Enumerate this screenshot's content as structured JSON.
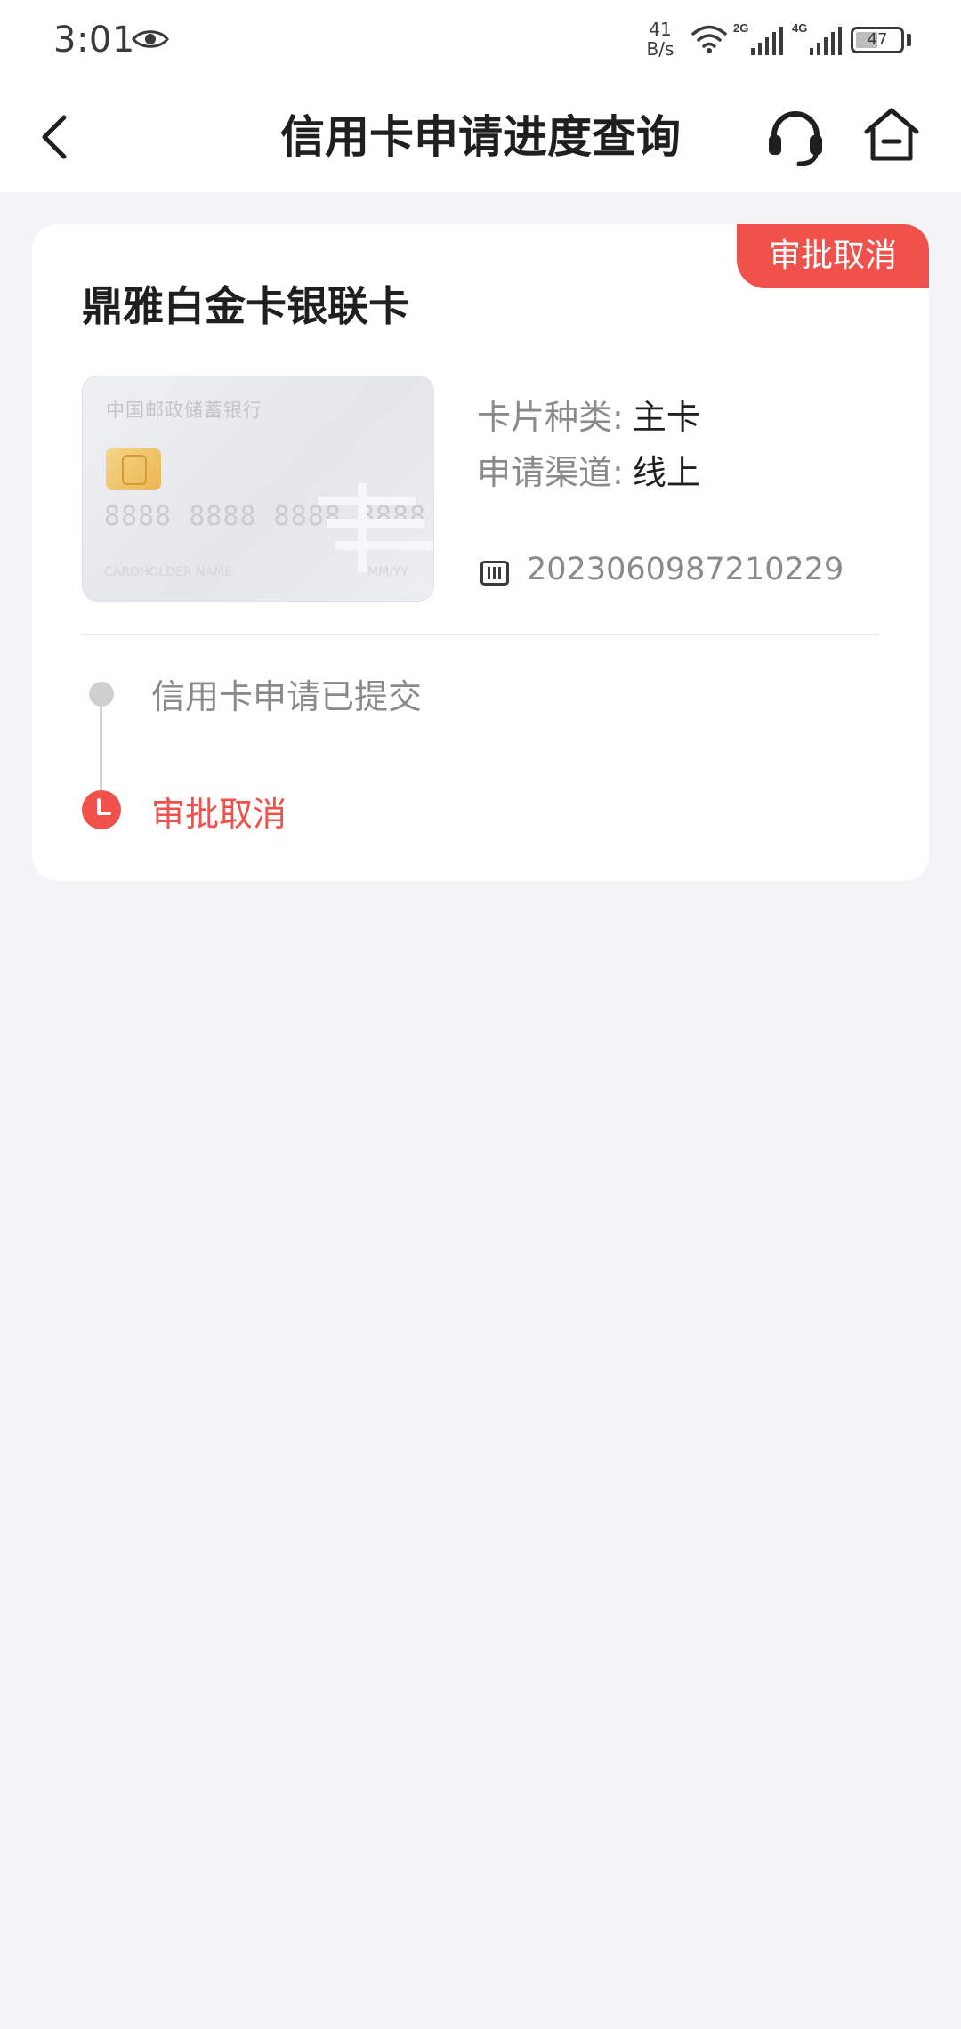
{
  "status_bar": {
    "time": "3:01",
    "net_speed_value": "41",
    "net_speed_unit": "B/s",
    "signal_1_label": "2G",
    "signal_2_label": "4G",
    "battery": "47"
  },
  "header": {
    "title": "信用卡申请进度查询"
  },
  "application": {
    "status_tag": "审批取消",
    "card_name": "鼎雅白金卡银联卡",
    "card_face": {
      "bank_name": "中国邮政储蓄银行",
      "number": "8888 8888 8888 8888",
      "holder": "CARDHOLDER NAME",
      "expiry": "MM/YY"
    },
    "details": {
      "type_label": "卡片种类:",
      "type_value": "主卡",
      "channel_label": "申请渠道:",
      "channel_value": "线上"
    },
    "application_number": "2023060987210229"
  },
  "timeline": [
    {
      "label": "信用卡申请已提交"
    },
    {
      "label": "审批取消"
    }
  ],
  "colors": {
    "accent": "#f0524b",
    "background": "#f4f4f8"
  }
}
